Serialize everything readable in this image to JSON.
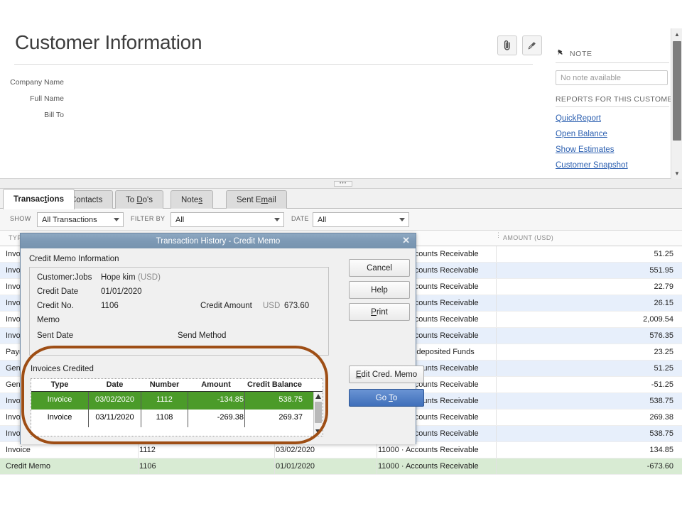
{
  "customer_panel": {
    "title": "Customer Information",
    "labels": [
      "Company Name",
      "Full Name",
      "Bill To"
    ],
    "attach_icon": "paperclip-icon",
    "edit_icon": "pencil-icon"
  },
  "note_panel": {
    "pin_icon": "pin-icon",
    "note_heading": "NOTE",
    "note_placeholder": "No note available",
    "reports_heading": "REPORTS FOR THIS CUSTOMER",
    "links": [
      "QuickReport",
      "Open Balance",
      "Show Estimates",
      "Customer Snapshot"
    ],
    "link_color": "#2b5fb0"
  },
  "tabs": [
    {
      "label": "Transactions",
      "active": true
    },
    {
      "label": "Contacts",
      "active": false
    },
    {
      "label": "To Do's",
      "active": false
    },
    {
      "label": "Notes",
      "active": false
    },
    {
      "label": "Sent Email",
      "active": false
    }
  ],
  "filter_bar": {
    "show_label": "SHOW",
    "show_value": "All Transactions",
    "filter_label": "FILTER BY",
    "filter_value": "All",
    "date_label": "DATE",
    "date_value": "All"
  },
  "transaction_table": {
    "headers": {
      "type": "TYPE",
      "amount": "AMOUNT (USD)"
    },
    "rows": [
      {
        "type": "Invoice",
        "number": "",
        "date": "",
        "account": "11000 · Accounts Receivable",
        "amount": "51.25",
        "style": "plain"
      },
      {
        "type": "Invoice",
        "number": "",
        "date": "",
        "account": "11000 · Accounts Receivable",
        "amount": "551.95",
        "style": "alt"
      },
      {
        "type": "Invoice",
        "number": "",
        "date": "",
        "account": "11000 · Accounts Receivable",
        "amount": "22.79",
        "style": "plain"
      },
      {
        "type": "Invoice",
        "number": "",
        "date": "",
        "account": "11000 · Accounts Receivable",
        "amount": "26.15",
        "style": "alt"
      },
      {
        "type": "Invoice",
        "number": "",
        "date": "",
        "account": "11000 · Accounts Receivable",
        "amount": "2,009.54",
        "style": "plain"
      },
      {
        "type": "Invoice",
        "number": "",
        "date": "",
        "account": "11000 · Accounts Receivable",
        "amount": "576.35",
        "style": "alt"
      },
      {
        "type": "Payment",
        "number": "",
        "date": "",
        "account": "12000 · Undeposited Funds",
        "amount": "23.25",
        "style": "plain"
      },
      {
        "type": "General Journal",
        "number": "",
        "date": "",
        "account": "11000 · Accounts Receivable",
        "amount": "51.25",
        "style": "alt"
      },
      {
        "type": "General Journal",
        "number": "",
        "date": "",
        "account": "11000 · Accounts Receivable",
        "amount": "-51.25",
        "style": "plain"
      },
      {
        "type": "Invoice",
        "number": "",
        "date": "",
        "account": "11000 · Accounts Receivable",
        "amount": "538.75",
        "style": "alt"
      },
      {
        "type": "Invoice",
        "number": "",
        "date": "",
        "account": "11000 · Accounts Receivable",
        "amount": "269.38",
        "style": "plain"
      },
      {
        "type": "Invoice",
        "number": "",
        "date": "",
        "account": "11000 · Accounts Receivable",
        "amount": "538.75",
        "style": "alt"
      },
      {
        "type": "Invoice",
        "number": "1112",
        "date": "03/02/2020",
        "account": "11000 · Accounts Receivable",
        "amount": "134.85",
        "style": "plain"
      },
      {
        "type": "Credit Memo",
        "number": "1106",
        "date": "01/01/2020",
        "account": "11000 · Accounts Receivable",
        "amount": "-673.60",
        "style": "sel"
      }
    ]
  },
  "dialog": {
    "title": "Transaction History - Credit Memo",
    "close_icon": "close-icon",
    "section_label": "Credit Memo Information",
    "fields": {
      "customer_jobs_label": "Customer:Jobs",
      "customer_jobs_value": "Hope kim",
      "customer_jobs_currency": "(USD)",
      "credit_date_label": "Credit Date",
      "credit_date_value": "01/01/2020",
      "credit_no_label": "Credit No.",
      "credit_no_value": "1106",
      "credit_amount_label": "Credit Amount",
      "credit_amount_currency": "USD",
      "credit_amount_value": "673.60",
      "memo_label": "Memo",
      "sent_date_label": "Sent Date",
      "send_method_label": "Send Method"
    },
    "invoices_credited": {
      "label": "Invoices Credited",
      "columns": [
        "Type",
        "Date",
        "Number",
        "Amount",
        "Credit Balance"
      ],
      "rows": [
        {
          "type": "Invoice",
          "date": "03/02/2020",
          "number": "1112",
          "amount": "-134.85",
          "credit_balance": "538.75",
          "selected": true
        },
        {
          "type": "Invoice",
          "date": "03/11/2020",
          "number": "1108",
          "amount": "-269.38",
          "credit_balance": "269.37",
          "selected": false
        }
      ],
      "selected_row_color": "#4b9b29"
    },
    "buttons": [
      {
        "label": "Cancel",
        "primary": false
      },
      {
        "label": "Help",
        "primary": false
      },
      {
        "label": "Print",
        "primary": false
      },
      {
        "label": "Edit Cred. Memo",
        "primary": false
      },
      {
        "label": "Go To",
        "primary": true
      }
    ]
  },
  "annotation": {
    "highlight_color": "#9e4e15",
    "shape": "rounded-rectangle-ellipse"
  }
}
